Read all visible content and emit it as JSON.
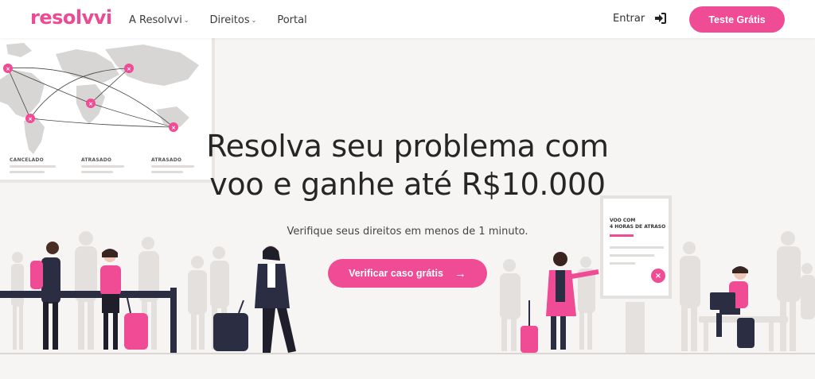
{
  "header": {
    "logo": "resolvvi",
    "nav": [
      {
        "label": "A Resolvvi",
        "has_dropdown": true
      },
      {
        "label": "Direitos",
        "has_dropdown": true
      },
      {
        "label": "Portal",
        "has_dropdown": false
      }
    ],
    "login_label": "Entrar",
    "login_icon": "sign-in-icon",
    "cta_label": "Teste Grátis"
  },
  "hero": {
    "title_line1": "Resolva seu problema com",
    "title_line2": "voo e ganhe até R$10.000",
    "subtitle": "Verifique seus direitos em menos de 1 minuto.",
    "cta_label": "Verificar caso grátis",
    "cta_icon": "arrow-right-icon"
  },
  "flight_board": {
    "statuses": [
      "CANCELADO",
      "ATRASADO",
      "ATRASADO"
    ]
  },
  "delay_sign": {
    "text_line1": "VOO COM",
    "text_line2": "4 HORAS DE ATRASO"
  },
  "colors": {
    "brand_pink": "#f04b95",
    "background": "#f7f5f3",
    "text_dark": "#262626"
  }
}
